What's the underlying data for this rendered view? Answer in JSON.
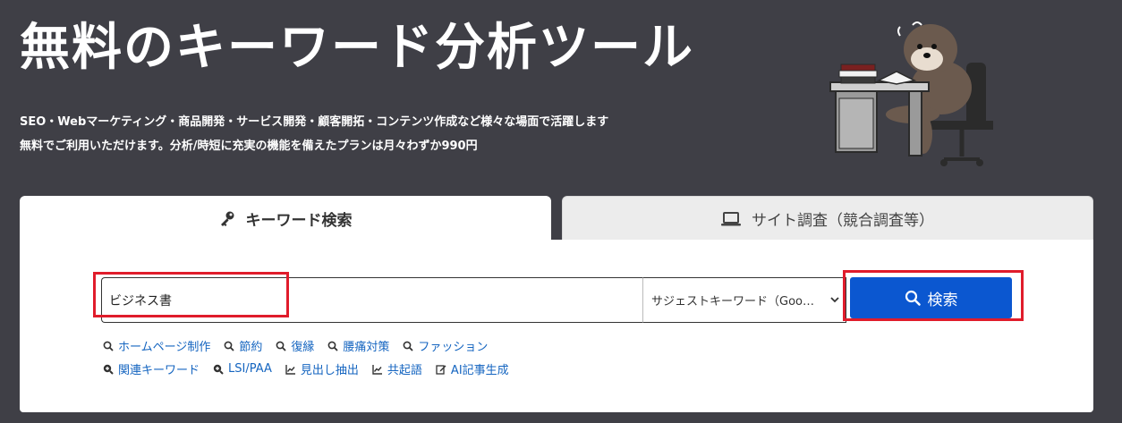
{
  "header": {
    "title": "無料のキーワード分析ツール",
    "description_line1": "SEO・Webマーケティング・商品開発・サービス開発・顧客開拓・コンテンツ作成など様々な場面で活躍します",
    "description_line2": "無料でご利用いただけます。分析/時短に充実の機能を備えたプランは月々わずか990円"
  },
  "tabs": [
    {
      "label": "キーワード検索",
      "icon": "key-icon",
      "active": true
    },
    {
      "label": "サイト調査（競合調査等）",
      "icon": "laptop-icon",
      "active": false
    }
  ],
  "search": {
    "value": "ビジネス書",
    "mode_selected": "サジェストキーワード（Google）",
    "button_label": "検索"
  },
  "quick_links": [
    {
      "label": "ホームページ制作",
      "icon": "search-icon"
    },
    {
      "label": "節約",
      "icon": "search-icon"
    },
    {
      "label": "復縁",
      "icon": "search-icon"
    },
    {
      "label": "腰痛対策",
      "icon": "search-icon"
    },
    {
      "label": "ファッション",
      "icon": "search-icon"
    }
  ],
  "tools": [
    {
      "label": "関連キーワード",
      "icon": "search-plus-icon"
    },
    {
      "label": "LSI/PAA",
      "icon": "search-plus-icon"
    },
    {
      "label": "見出し抽出",
      "icon": "chart-line-icon"
    },
    {
      "label": "共起語",
      "icon": "chart-line-icon"
    },
    {
      "label": "AI記事生成",
      "icon": "edit-icon"
    }
  ],
  "colors": {
    "background": "#3f3f46",
    "accent": "#0b57d0",
    "highlight": "#e01c2b",
    "link": "#1565c0"
  }
}
